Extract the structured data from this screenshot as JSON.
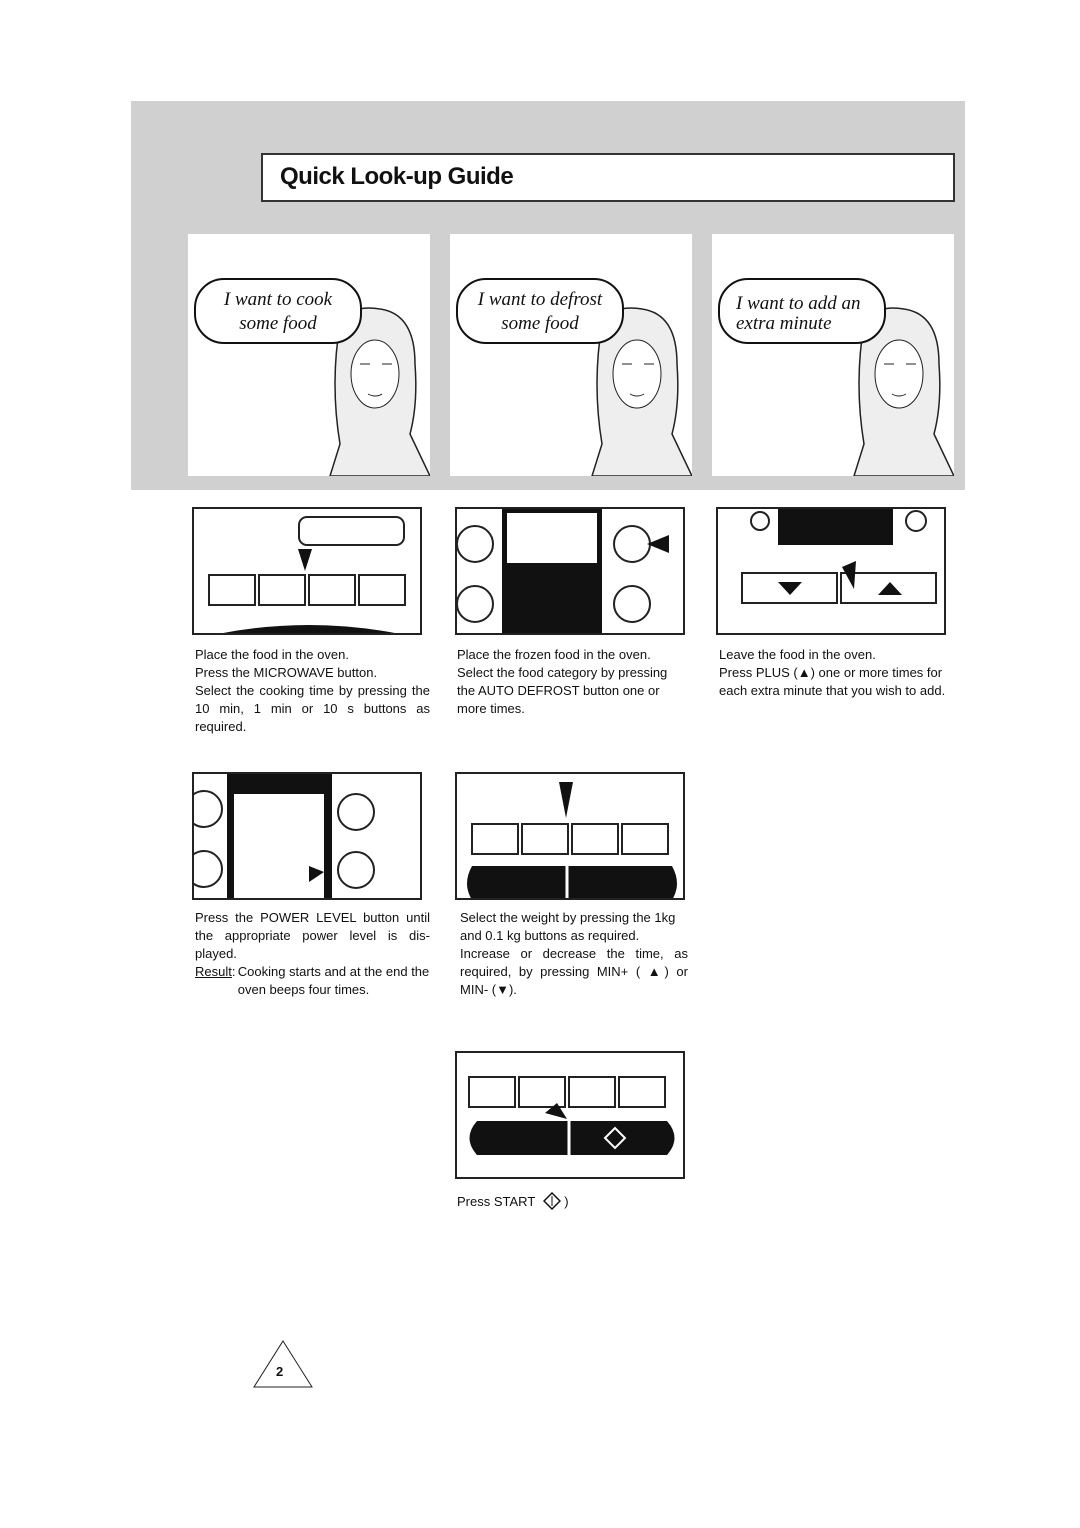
{
  "title": "Quick Look-up Guide",
  "scenes": [
    {
      "line1": "I want to cook",
      "line2": "some food"
    },
    {
      "line1": "I want to defrost",
      "line2": "some food"
    },
    {
      "line1": "I want to add an",
      "line2": "extra minute"
    }
  ],
  "steps": {
    "cook": [
      "Place the food in the oven.",
      "Press the MICROWAVE button.",
      "Select the cooking time by pressing the 10 min, 1 min or 10 s buttons as required."
    ],
    "defrost": [
      "Place the frozen food in the oven.",
      "Select the food category by pressing the AUTO DEFROST button one or more times."
    ],
    "extra": [
      "Leave the food in the oven.",
      "Press PLUS (▲) one or more times for each extra minute that you wish to add."
    ],
    "power": [
      "Press the POWER LEVEL button until the appropriate power level is dis-played."
    ],
    "result_label": "Result",
    "result_text": "Cooking starts and at the end the oven beeps four times.",
    "weight": [
      "Select the weight by pressing the 1kg and 0.1 kg buttons as required.",
      "Increase or decrease the time, as required, by pressing MIN+ ( ▲) or MIN- (▼)."
    ],
    "start": "Press START",
    "start_icon": "start-diamond-icon"
  },
  "page_number": "2"
}
